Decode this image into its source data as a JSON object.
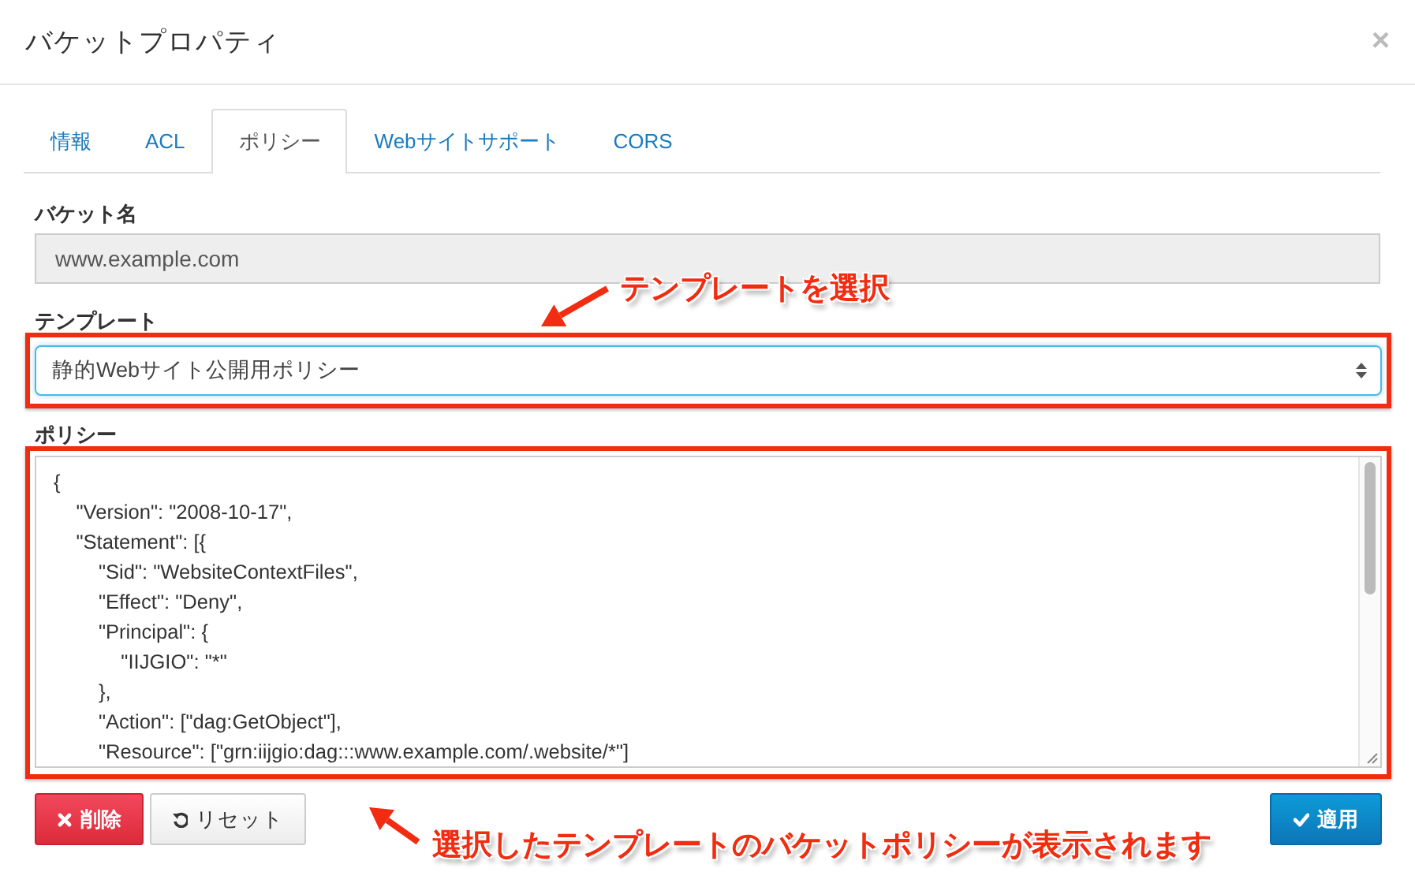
{
  "window": {
    "title": "バケットプロパティ",
    "close": "×"
  },
  "tabs": [
    {
      "label": "情報",
      "selected": false
    },
    {
      "label": "ACL",
      "selected": false
    },
    {
      "label": "ポリシー",
      "selected": true
    },
    {
      "label": "Webサイトサポート",
      "selected": false
    },
    {
      "label": "CORS",
      "selected": false
    }
  ],
  "bucket_name": {
    "label": "バケット名",
    "value": "www.example.com",
    "disabled": true
  },
  "template": {
    "label": "テンプレート",
    "value": "静的Webサイト公開用ポリシー"
  },
  "policy": {
    "label": "ポリシー",
    "text": "{\n    \"Version\": \"2008-10-17\",\n    \"Statement\": [{\n        \"Sid\": \"WebsiteContextFiles\",\n        \"Effect\": \"Deny\",\n        \"Principal\": {\n            \"IIJGIO\": \"*\"\n        },\n        \"Action\": [\"dag:GetObject\"],\n        \"Resource\": [\"grn:iijgio:dag:::www.example.com/.website/*\"]"
  },
  "buttons": [
    {
      "label": "削除",
      "kind": "danger"
    },
    {
      "label": "リセット",
      "kind": "reset"
    },
    {
      "label": "適用",
      "kind": "primary"
    }
  ],
  "annotations": [
    {
      "text": "テンプレートを選択"
    },
    {
      "text": "選択したテンプレートのバケットポリシーが表示されます"
    }
  ]
}
